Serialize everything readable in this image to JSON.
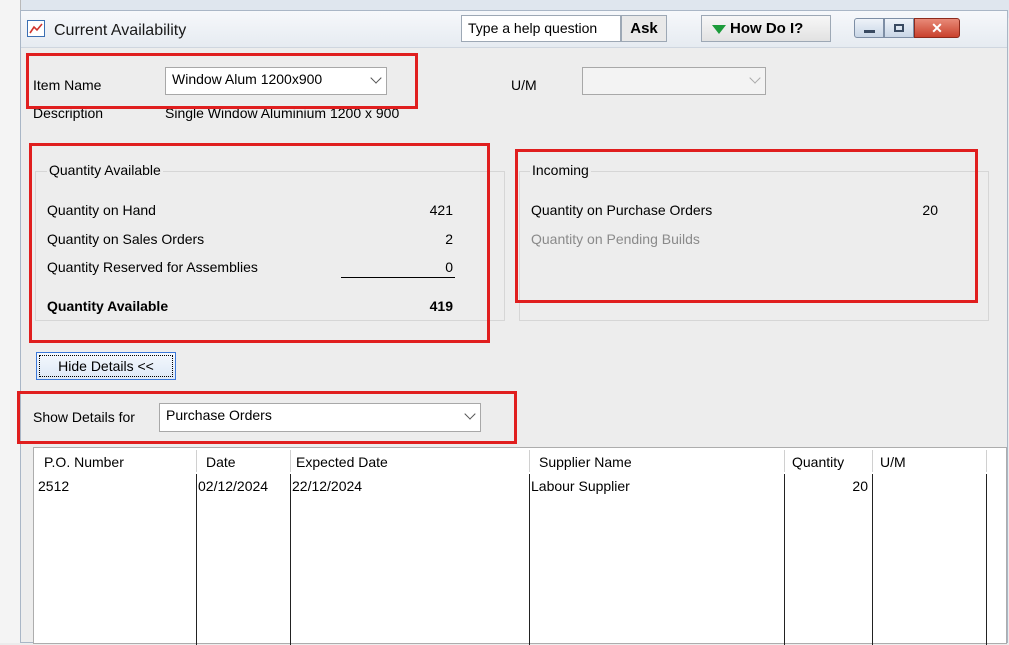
{
  "window": {
    "title": "Current Availability"
  },
  "help": {
    "placeholder": "Type a help question",
    "ask_label": "Ask",
    "howdoi_label": "How Do I?",
    "close_glyph": "✕"
  },
  "item": {
    "name_label": "Item Name",
    "name_value": "Window Alum 1200x900",
    "description_label": "Description",
    "description_value": "Single Window Aluminium 1200 x 900",
    "um_label": "U/M",
    "um_value": ""
  },
  "quantity_available": {
    "group_label": "Quantity Available",
    "rows": [
      {
        "label": "Quantity on Hand",
        "value": "421"
      },
      {
        "label": "Quantity on Sales Orders",
        "value": "2"
      },
      {
        "label": "Quantity Reserved for Assemblies",
        "value": "0"
      }
    ],
    "total_label": "Quantity Available",
    "total_value": "419"
  },
  "incoming": {
    "group_label": "Incoming",
    "purchase_orders_label": "Quantity on Purchase Orders",
    "purchase_orders_value": "20",
    "pending_builds_label": "Quantity on Pending Builds"
  },
  "details": {
    "hide_button_label": "Hide Details <<",
    "show_for_label": "Show Details for",
    "show_for_value": "Purchase Orders"
  },
  "table": {
    "headers": [
      "P.O. Number",
      "Date",
      "Expected Date",
      "Supplier Name",
      "Quantity",
      "U/M"
    ],
    "rows": [
      {
        "po": "2512",
        "date": "02/12/2024",
        "expected": "22/12/2024",
        "supplier": "Labour Supplier",
        "qty": "20",
        "um": ""
      }
    ]
  },
  "colors": {
    "highlight_red": "#e01e1e",
    "accent_green": "#1c9b3a"
  }
}
